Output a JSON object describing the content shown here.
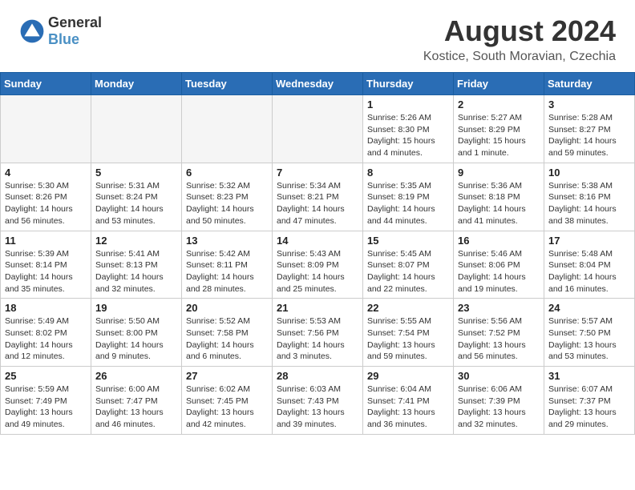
{
  "header": {
    "logo_general": "General",
    "logo_blue": "Blue",
    "month_year": "August 2024",
    "location": "Kostice, South Moravian, Czechia"
  },
  "days_of_week": [
    "Sunday",
    "Monday",
    "Tuesday",
    "Wednesday",
    "Thursday",
    "Friday",
    "Saturday"
  ],
  "weeks": [
    [
      {
        "day": "",
        "info": ""
      },
      {
        "day": "",
        "info": ""
      },
      {
        "day": "",
        "info": ""
      },
      {
        "day": "",
        "info": ""
      },
      {
        "day": "1",
        "info": "Sunrise: 5:26 AM\nSunset: 8:30 PM\nDaylight: 15 hours\nand 4 minutes."
      },
      {
        "day": "2",
        "info": "Sunrise: 5:27 AM\nSunset: 8:29 PM\nDaylight: 15 hours\nand 1 minute."
      },
      {
        "day": "3",
        "info": "Sunrise: 5:28 AM\nSunset: 8:27 PM\nDaylight: 14 hours\nand 59 minutes."
      }
    ],
    [
      {
        "day": "4",
        "info": "Sunrise: 5:30 AM\nSunset: 8:26 PM\nDaylight: 14 hours\nand 56 minutes."
      },
      {
        "day": "5",
        "info": "Sunrise: 5:31 AM\nSunset: 8:24 PM\nDaylight: 14 hours\nand 53 minutes."
      },
      {
        "day": "6",
        "info": "Sunrise: 5:32 AM\nSunset: 8:23 PM\nDaylight: 14 hours\nand 50 minutes."
      },
      {
        "day": "7",
        "info": "Sunrise: 5:34 AM\nSunset: 8:21 PM\nDaylight: 14 hours\nand 47 minutes."
      },
      {
        "day": "8",
        "info": "Sunrise: 5:35 AM\nSunset: 8:19 PM\nDaylight: 14 hours\nand 44 minutes."
      },
      {
        "day": "9",
        "info": "Sunrise: 5:36 AM\nSunset: 8:18 PM\nDaylight: 14 hours\nand 41 minutes."
      },
      {
        "day": "10",
        "info": "Sunrise: 5:38 AM\nSunset: 8:16 PM\nDaylight: 14 hours\nand 38 minutes."
      }
    ],
    [
      {
        "day": "11",
        "info": "Sunrise: 5:39 AM\nSunset: 8:14 PM\nDaylight: 14 hours\nand 35 minutes."
      },
      {
        "day": "12",
        "info": "Sunrise: 5:41 AM\nSunset: 8:13 PM\nDaylight: 14 hours\nand 32 minutes."
      },
      {
        "day": "13",
        "info": "Sunrise: 5:42 AM\nSunset: 8:11 PM\nDaylight: 14 hours\nand 28 minutes."
      },
      {
        "day": "14",
        "info": "Sunrise: 5:43 AM\nSunset: 8:09 PM\nDaylight: 14 hours\nand 25 minutes."
      },
      {
        "day": "15",
        "info": "Sunrise: 5:45 AM\nSunset: 8:07 PM\nDaylight: 14 hours\nand 22 minutes."
      },
      {
        "day": "16",
        "info": "Sunrise: 5:46 AM\nSunset: 8:06 PM\nDaylight: 14 hours\nand 19 minutes."
      },
      {
        "day": "17",
        "info": "Sunrise: 5:48 AM\nSunset: 8:04 PM\nDaylight: 14 hours\nand 16 minutes."
      }
    ],
    [
      {
        "day": "18",
        "info": "Sunrise: 5:49 AM\nSunset: 8:02 PM\nDaylight: 14 hours\nand 12 minutes."
      },
      {
        "day": "19",
        "info": "Sunrise: 5:50 AM\nSunset: 8:00 PM\nDaylight: 14 hours\nand 9 minutes."
      },
      {
        "day": "20",
        "info": "Sunrise: 5:52 AM\nSunset: 7:58 PM\nDaylight: 14 hours\nand 6 minutes."
      },
      {
        "day": "21",
        "info": "Sunrise: 5:53 AM\nSunset: 7:56 PM\nDaylight: 14 hours\nand 3 minutes."
      },
      {
        "day": "22",
        "info": "Sunrise: 5:55 AM\nSunset: 7:54 PM\nDaylight: 13 hours\nand 59 minutes."
      },
      {
        "day": "23",
        "info": "Sunrise: 5:56 AM\nSunset: 7:52 PM\nDaylight: 13 hours\nand 56 minutes."
      },
      {
        "day": "24",
        "info": "Sunrise: 5:57 AM\nSunset: 7:50 PM\nDaylight: 13 hours\nand 53 minutes."
      }
    ],
    [
      {
        "day": "25",
        "info": "Sunrise: 5:59 AM\nSunset: 7:49 PM\nDaylight: 13 hours\nand 49 minutes."
      },
      {
        "day": "26",
        "info": "Sunrise: 6:00 AM\nSunset: 7:47 PM\nDaylight: 13 hours\nand 46 minutes."
      },
      {
        "day": "27",
        "info": "Sunrise: 6:02 AM\nSunset: 7:45 PM\nDaylight: 13 hours\nand 42 minutes."
      },
      {
        "day": "28",
        "info": "Sunrise: 6:03 AM\nSunset: 7:43 PM\nDaylight: 13 hours\nand 39 minutes."
      },
      {
        "day": "29",
        "info": "Sunrise: 6:04 AM\nSunset: 7:41 PM\nDaylight: 13 hours\nand 36 minutes."
      },
      {
        "day": "30",
        "info": "Sunrise: 6:06 AM\nSunset: 7:39 PM\nDaylight: 13 hours\nand 32 minutes."
      },
      {
        "day": "31",
        "info": "Sunrise: 6:07 AM\nSunset: 7:37 PM\nDaylight: 13 hours\nand 29 minutes."
      }
    ]
  ]
}
